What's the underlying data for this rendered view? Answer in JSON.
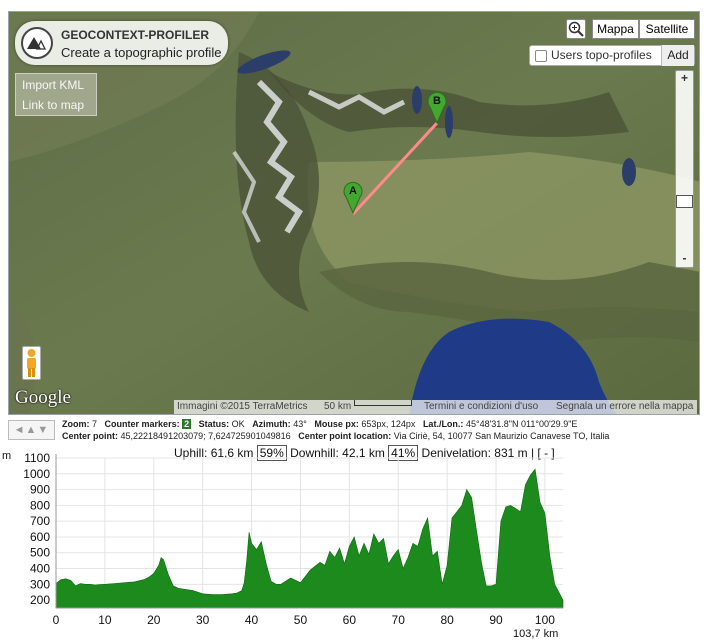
{
  "app": {
    "title": "GEOCONTEXT-PROFILER",
    "subtitle": "Create a topographic profile",
    "menu": {
      "import_kml": "Import KML",
      "link_to_map": "Link to map"
    }
  },
  "map": {
    "type_map": "Mappa",
    "type_satellite": "Satellite",
    "users_profiles": "Users topo-profiles",
    "add": "Add",
    "zoom_plus": "+",
    "zoom_minus": "-",
    "markers": [
      {
        "label": "A",
        "color": "#43a82f"
      },
      {
        "label": "B",
        "color": "#43a82f"
      }
    ],
    "route_color": "#ff8a8a",
    "google_logo": "Google",
    "attribution": {
      "imagery": "Immagini ©2015 TerraMetrics",
      "scale": "50 km",
      "terms": "Termini e condizioni d'uso",
      "report": "Segnala un errore nella mappa"
    }
  },
  "info": {
    "nav": "◄▲▼",
    "zoom_label": "Zoom:",
    "zoom_value": "7",
    "counter_label": "Counter markers:",
    "counter_value": "2",
    "status_label": "Status:",
    "status_value": "OK",
    "azimuth_label": "Azimuth:",
    "azimuth_value": "43°",
    "mouse_label": "Mouse px:",
    "mouse_value": "653px, 124px",
    "latlon_label": "Lat./Lon.:",
    "latlon_value": "45°48'31.8\"N 011°00'29.9\"E",
    "center_label": "Center point:",
    "center_value": "45,22218491203079; 7,624725901049816",
    "center_loc_label": "Center point location:",
    "center_loc_value": "Via Ciriè, 54, 10077 San Maurizio Canavese TO, Italia"
  },
  "profile": {
    "uphill_label": "Uphill:",
    "uphill_value": "61,6 km",
    "uphill_pct": "59%",
    "downhill_label": "Downhill:",
    "downhill_value": "42,1 km",
    "downhill_pct": "41%",
    "deniv_label": "Denivelation:",
    "deniv_value": "831 m",
    "controls": "| [ - ]",
    "y_unit": "m",
    "total_distance": "103,7 km"
  },
  "chart_data": {
    "type": "area",
    "color": "#1d8a1d",
    "xlim": [
      0,
      103.7
    ],
    "ylim": [
      150,
      1100
    ],
    "x_ticks": [
      0,
      10,
      20,
      30,
      40,
      50,
      60,
      70,
      80,
      90,
      100
    ],
    "y_ticks": [
      200,
      300,
      400,
      500,
      600,
      700,
      800,
      900,
      1000,
      1100
    ],
    "x": [
      0,
      1,
      2,
      3,
      4,
      5,
      6,
      7,
      8,
      9,
      10,
      12,
      14,
      16,
      18,
      19,
      20,
      21,
      21.5,
      22,
      23,
      24,
      25,
      26,
      28,
      30,
      32,
      34,
      36,
      37,
      38,
      38.5,
      39,
      39.5,
      40,
      41,
      42,
      43,
      44,
      45,
      46,
      48,
      50,
      52,
      54,
      55,
      56,
      57,
      58,
      59,
      60,
      61,
      62,
      63,
      64,
      65,
      66,
      67,
      68,
      69,
      70,
      71,
      72,
      73,
      74,
      75,
      76,
      77,
      78,
      79,
      80,
      81,
      82,
      83,
      84,
      85,
      86,
      87,
      88,
      89,
      90,
      91,
      92,
      93,
      94,
      95,
      96,
      97,
      98,
      99,
      100,
      101,
      102,
      103.7
    ],
    "y": [
      305,
      330,
      335,
      325,
      290,
      305,
      300,
      300,
      295,
      298,
      300,
      305,
      310,
      315,
      330,
      345,
      370,
      420,
      470,
      455,
      360,
      290,
      275,
      270,
      260,
      240,
      235,
      235,
      240,
      245,
      260,
      310,
      450,
      630,
      560,
      520,
      570,
      430,
      320,
      300,
      300,
      340,
      310,
      390,
      440,
      420,
      510,
      470,
      530,
      430,
      540,
      600,
      480,
      560,
      490,
      620,
      560,
      590,
      430,
      480,
      520,
      400,
      470,
      560,
      540,
      650,
      720,
      480,
      510,
      300,
      420,
      720,
      760,
      800,
      900,
      850,
      640,
      440,
      290,
      290,
      300,
      700,
      790,
      800,
      780,
      760,
      930,
      990,
      1030,
      820,
      750,
      480,
      300,
      200,
      180
    ]
  }
}
